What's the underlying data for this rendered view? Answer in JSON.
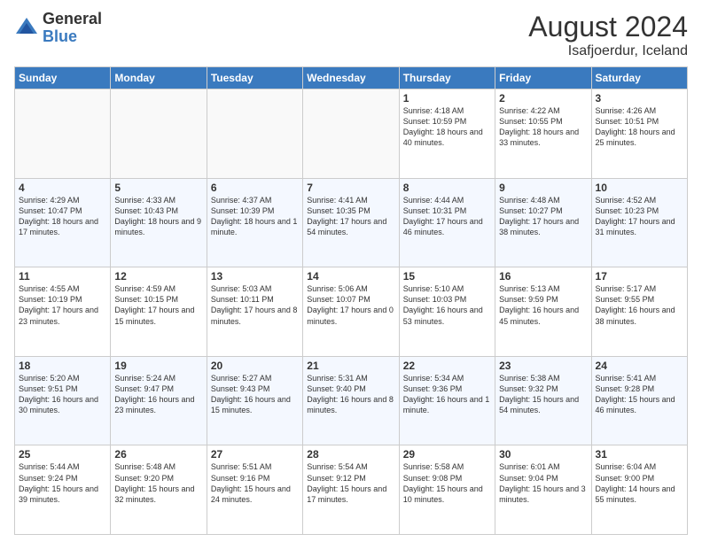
{
  "logo": {
    "general": "General",
    "blue": "Blue"
  },
  "title": {
    "month_year": "August 2024",
    "location": "Isafjoerdur, Iceland"
  },
  "days_of_week": [
    "Sunday",
    "Monday",
    "Tuesday",
    "Wednesday",
    "Thursday",
    "Friday",
    "Saturday"
  ],
  "weeks": [
    [
      {
        "day": "",
        "info": ""
      },
      {
        "day": "",
        "info": ""
      },
      {
        "day": "",
        "info": ""
      },
      {
        "day": "",
        "info": ""
      },
      {
        "day": "1",
        "info": "Sunrise: 4:18 AM\nSunset: 10:59 PM\nDaylight: 18 hours\nand 40 minutes."
      },
      {
        "day": "2",
        "info": "Sunrise: 4:22 AM\nSunset: 10:55 PM\nDaylight: 18 hours\nand 33 minutes."
      },
      {
        "day": "3",
        "info": "Sunrise: 4:26 AM\nSunset: 10:51 PM\nDaylight: 18 hours\nand 25 minutes."
      }
    ],
    [
      {
        "day": "4",
        "info": "Sunrise: 4:29 AM\nSunset: 10:47 PM\nDaylight: 18 hours\nand 17 minutes."
      },
      {
        "day": "5",
        "info": "Sunrise: 4:33 AM\nSunset: 10:43 PM\nDaylight: 18 hours\nand 9 minutes."
      },
      {
        "day": "6",
        "info": "Sunrise: 4:37 AM\nSunset: 10:39 PM\nDaylight: 18 hours\nand 1 minute."
      },
      {
        "day": "7",
        "info": "Sunrise: 4:41 AM\nSunset: 10:35 PM\nDaylight: 17 hours\nand 54 minutes."
      },
      {
        "day": "8",
        "info": "Sunrise: 4:44 AM\nSunset: 10:31 PM\nDaylight: 17 hours\nand 46 minutes."
      },
      {
        "day": "9",
        "info": "Sunrise: 4:48 AM\nSunset: 10:27 PM\nDaylight: 17 hours\nand 38 minutes."
      },
      {
        "day": "10",
        "info": "Sunrise: 4:52 AM\nSunset: 10:23 PM\nDaylight: 17 hours\nand 31 minutes."
      }
    ],
    [
      {
        "day": "11",
        "info": "Sunrise: 4:55 AM\nSunset: 10:19 PM\nDaylight: 17 hours\nand 23 minutes."
      },
      {
        "day": "12",
        "info": "Sunrise: 4:59 AM\nSunset: 10:15 PM\nDaylight: 17 hours\nand 15 minutes."
      },
      {
        "day": "13",
        "info": "Sunrise: 5:03 AM\nSunset: 10:11 PM\nDaylight: 17 hours\nand 8 minutes."
      },
      {
        "day": "14",
        "info": "Sunrise: 5:06 AM\nSunset: 10:07 PM\nDaylight: 17 hours\nand 0 minutes."
      },
      {
        "day": "15",
        "info": "Sunrise: 5:10 AM\nSunset: 10:03 PM\nDaylight: 16 hours\nand 53 minutes."
      },
      {
        "day": "16",
        "info": "Sunrise: 5:13 AM\nSunset: 9:59 PM\nDaylight: 16 hours\nand 45 minutes."
      },
      {
        "day": "17",
        "info": "Sunrise: 5:17 AM\nSunset: 9:55 PM\nDaylight: 16 hours\nand 38 minutes."
      }
    ],
    [
      {
        "day": "18",
        "info": "Sunrise: 5:20 AM\nSunset: 9:51 PM\nDaylight: 16 hours\nand 30 minutes."
      },
      {
        "day": "19",
        "info": "Sunrise: 5:24 AM\nSunset: 9:47 PM\nDaylight: 16 hours\nand 23 minutes."
      },
      {
        "day": "20",
        "info": "Sunrise: 5:27 AM\nSunset: 9:43 PM\nDaylight: 16 hours\nand 15 minutes."
      },
      {
        "day": "21",
        "info": "Sunrise: 5:31 AM\nSunset: 9:40 PM\nDaylight: 16 hours\nand 8 minutes."
      },
      {
        "day": "22",
        "info": "Sunrise: 5:34 AM\nSunset: 9:36 PM\nDaylight: 16 hours\nand 1 minute."
      },
      {
        "day": "23",
        "info": "Sunrise: 5:38 AM\nSunset: 9:32 PM\nDaylight: 15 hours\nand 54 minutes."
      },
      {
        "day": "24",
        "info": "Sunrise: 5:41 AM\nSunset: 9:28 PM\nDaylight: 15 hours\nand 46 minutes."
      }
    ],
    [
      {
        "day": "25",
        "info": "Sunrise: 5:44 AM\nSunset: 9:24 PM\nDaylight: 15 hours\nand 39 minutes."
      },
      {
        "day": "26",
        "info": "Sunrise: 5:48 AM\nSunset: 9:20 PM\nDaylight: 15 hours\nand 32 minutes."
      },
      {
        "day": "27",
        "info": "Sunrise: 5:51 AM\nSunset: 9:16 PM\nDaylight: 15 hours\nand 24 minutes."
      },
      {
        "day": "28",
        "info": "Sunrise: 5:54 AM\nSunset: 9:12 PM\nDaylight: 15 hours\nand 17 minutes."
      },
      {
        "day": "29",
        "info": "Sunrise: 5:58 AM\nSunset: 9:08 PM\nDaylight: 15 hours\nand 10 minutes."
      },
      {
        "day": "30",
        "info": "Sunrise: 6:01 AM\nSunset: 9:04 PM\nDaylight: 15 hours\nand 3 minutes."
      },
      {
        "day": "31",
        "info": "Sunrise: 6:04 AM\nSunset: 9:00 PM\nDaylight: 14 hours\nand 55 minutes."
      }
    ]
  ]
}
